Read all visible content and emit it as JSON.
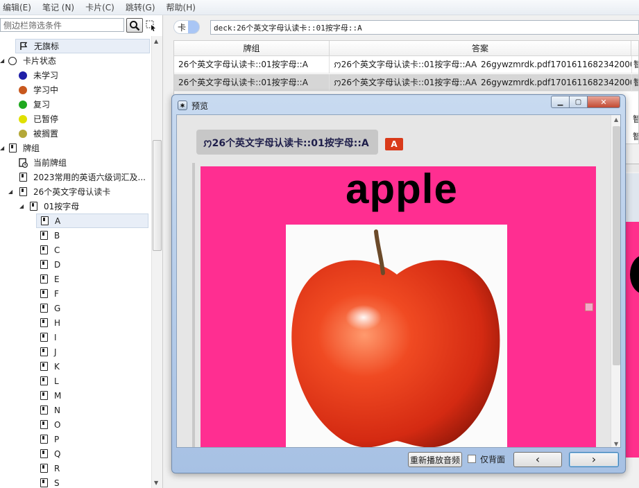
{
  "menu": [
    "编辑(E)",
    "笔记 (N)",
    "卡片(C)",
    "跳转(G)",
    "帮助(H)"
  ],
  "sidebar": {
    "search_placeholder": "侧边栏筛选条件",
    "flag_item": "无旗标",
    "card_state": {
      "label": "卡片状态",
      "items": [
        {
          "label": "未学习",
          "color": "#1f1fa8"
        },
        {
          "label": "学习中",
          "color": "#c8581e"
        },
        {
          "label": "复习",
          "color": "#1ea81e"
        },
        {
          "label": "已暂停",
          "color": "#e0e000"
        },
        {
          "label": "被搁置",
          "color": "#b4a838"
        }
      ]
    },
    "decks": {
      "label": "牌组",
      "current": "当前牌组",
      "deck1": "2023常用的英语六级词汇及...",
      "deck2": "26个英文字母认读卡",
      "subdeck": "01按字母",
      "letters": [
        "A",
        "B",
        "C",
        "D",
        "E",
        "F",
        "G",
        "H",
        "I",
        "J",
        "K",
        "L",
        "M",
        "N",
        "O",
        "P",
        "Q",
        "R",
        "S"
      ]
    }
  },
  "search": {
    "mode": "卡",
    "query": "deck:26个英文字母认读卡::01按字母::A"
  },
  "table": {
    "headers": [
      "牌组",
      "答案"
    ],
    "rows": [
      {
        "deck": "26个英文字母认读卡::01按字母::A",
        "answer_deck": "ꩀ26个英文字母认读卡::01按字母::AA",
        "answer_file": "26gywzmrdk.pdf1701611682342000...",
        "extra": "智"
      },
      {
        "deck": "26个英文字母认读卡::01按字母::A",
        "answer_deck": "ꩀ26个英文字母认读卡::01按字母::AA",
        "answer_file": "26gywzmrdk.pdf1701611682342000...",
        "extra": "智"
      }
    ],
    "extra_col": [
      "智",
      "智",
      "智"
    ]
  },
  "preview": {
    "title": "预览",
    "crumb": "ꩀ26个英文字母认读卡::01按字母::A",
    "tag": "A",
    "word": "apple",
    "replay_button": "重新播放音频",
    "back_only_label": "仅背面",
    "prev_symbol": "‹",
    "next_symbol": "›"
  },
  "colors": {
    "card_bg": "#ff2e91",
    "tag": "#d93a1a"
  }
}
